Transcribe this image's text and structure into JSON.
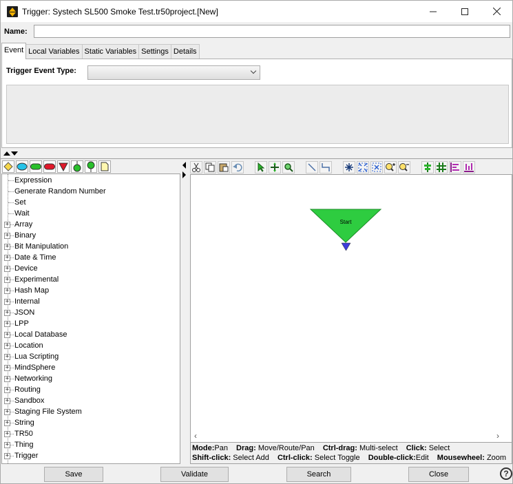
{
  "window": {
    "title": "Trigger:  Systech SL500 Smoke Test.tr50project.[New]",
    "app_icon": "app-logo-icon",
    "controls": {
      "minimize": "—",
      "maximize": "☐",
      "close": "✕"
    }
  },
  "name_field": {
    "label": "Name:",
    "value": ""
  },
  "tabs": [
    {
      "label": "Event",
      "active": true
    },
    {
      "label": "Local Variables",
      "active": false
    },
    {
      "label": "Static Variables",
      "active": false
    },
    {
      "label": "Settings",
      "active": false
    },
    {
      "label": "Details",
      "active": false
    }
  ],
  "event_panel": {
    "trigger_event_type_label": "Trigger Event Type:",
    "trigger_event_type_value": ""
  },
  "palette": {
    "shapes": [
      {
        "name": "diamond-shape-icon",
        "color": "#f6d74a"
      },
      {
        "name": "ellipse-shape-icon",
        "color": "#26c3e8"
      },
      {
        "name": "rounded-rect-green-icon",
        "color": "#29c02b"
      },
      {
        "name": "rounded-rect-red-icon",
        "color": "#e0192a"
      },
      {
        "name": "triangle-down-icon",
        "color": "#e0192a"
      },
      {
        "name": "bulb-down-icon",
        "color": "#29c02b"
      },
      {
        "name": "bulb-up-icon",
        "color": "#29c02b"
      },
      {
        "name": "note-icon",
        "color": "#fff8b0"
      }
    ]
  },
  "tree": {
    "leaf_items": [
      "Expression",
      "Generate Random Number",
      "Set",
      "Wait"
    ],
    "group_items": [
      "Array",
      "Binary",
      "Bit Manipulation",
      "Date & Time",
      "Device",
      "Experimental",
      "Hash Map",
      "Internal",
      "JSON",
      "LPP",
      "Local Database",
      "Location",
      "Lua Scripting",
      "MindSphere",
      "Networking",
      "Routing",
      "Sandbox",
      "Staging File System",
      "String",
      "TR50",
      "Thing",
      "Trigger"
    ]
  },
  "toolbar": {
    "tools": [
      "cut-icon",
      "copy-icon",
      "paste-icon",
      "undo-icon",
      "select-arrow-icon",
      "pan-move-icon",
      "zoom-icon",
      "line-icon",
      "route-line-icon",
      "pointer-star-icon",
      "fit-expand-icon",
      "fit-collapse-icon",
      "zoom-in-icon",
      "zoom-out-icon",
      "align-vertical-icon",
      "grid-icon",
      "distribute-horizontal-icon",
      "distribute-vertical-icon"
    ]
  },
  "canvas": {
    "start_node_label": "Start",
    "start_color": "#2ecc40",
    "port_color": "#3d3ddb"
  },
  "help": {
    "line1": [
      {
        "k": "Mode:",
        "v": "Pan"
      },
      {
        "k": "Drag:",
        "v": "Move/Route/Pan"
      },
      {
        "k": "Ctrl-drag:",
        "v": "Multi-select"
      },
      {
        "k": "Click:",
        "v": "Select"
      }
    ],
    "line2": [
      {
        "k": "Shift-click:",
        "v": "Select Add"
      },
      {
        "k": "Ctrl-click:",
        "v": "Select Toggle"
      },
      {
        "k": "Double-click:",
        "v": "Edit"
      },
      {
        "k": "Mousewheel:",
        "v": "Zoom"
      }
    ]
  },
  "buttons": {
    "save": "Save",
    "validate": "Validate",
    "search": "Search",
    "close": "Close",
    "help": "?"
  }
}
